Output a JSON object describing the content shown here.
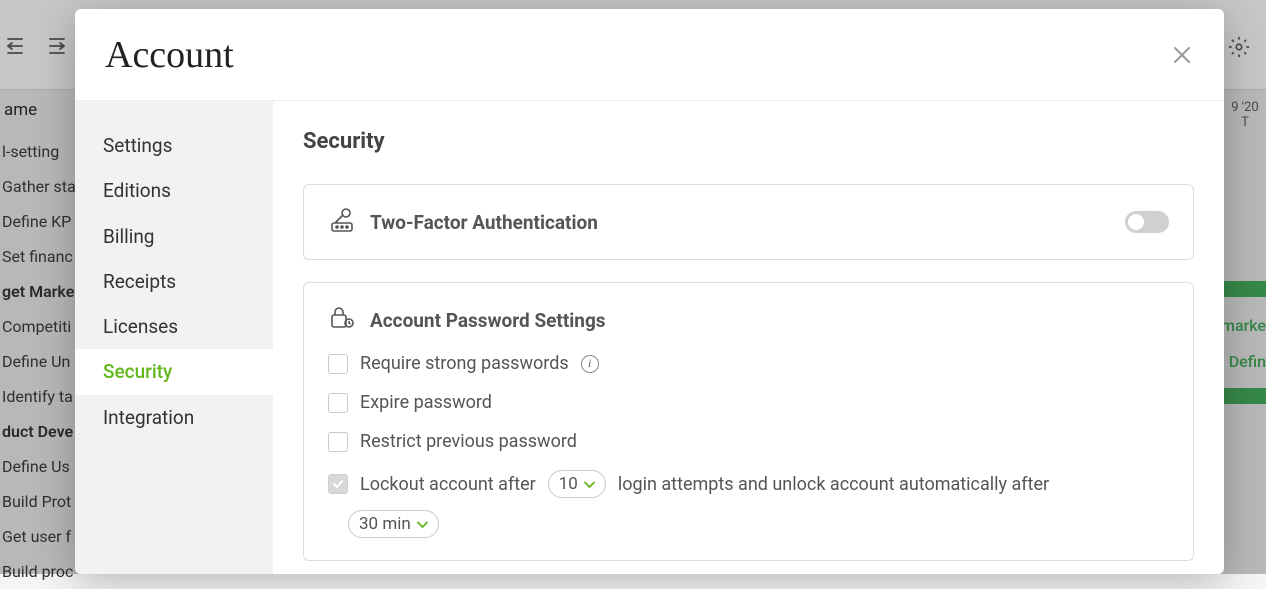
{
  "background": {
    "name_header": "ame",
    "right_date_top": "9 '20",
    "right_date_bottom": "T",
    "right_green_tasks": [
      "marke",
      "Defin"
    ],
    "tasks": [
      {
        "label": "l-setting",
        "bold": false
      },
      {
        "label": "Gather sta",
        "bold": false
      },
      {
        "label": "Define KP",
        "bold": false
      },
      {
        "label": "Set financ",
        "bold": false
      },
      {
        "label": "get Marke",
        "bold": true
      },
      {
        "label": "Competiti",
        "bold": false
      },
      {
        "label": "Define Un",
        "bold": false
      },
      {
        "label": "Identify ta",
        "bold": false
      },
      {
        "label": "duct Deve",
        "bold": true
      },
      {
        "label": "Define Us",
        "bold": false
      },
      {
        "label": "Build Prot",
        "bold": false
      },
      {
        "label": "Get user f",
        "bold": false
      },
      {
        "label": "Build proc",
        "bold": false
      }
    ]
  },
  "modal": {
    "title": "Account",
    "sidebar": {
      "items": [
        {
          "label": "Settings",
          "active": false
        },
        {
          "label": "Editions",
          "active": false
        },
        {
          "label": "Billing",
          "active": false
        },
        {
          "label": "Receipts",
          "active": false
        },
        {
          "label": "Licenses",
          "active": false
        },
        {
          "label": "Security",
          "active": true
        },
        {
          "label": "Integration",
          "active": false
        }
      ]
    },
    "content": {
      "heading": "Security",
      "two_factor": {
        "title": "Two-Factor Authentication",
        "enabled": false
      },
      "password_settings": {
        "title": "Account Password Settings",
        "require_strong_label": "Require strong passwords",
        "expire_label": "Expire password",
        "restrict_previous_label": "Restrict previous password",
        "lockout_prefix": "Lockout account after",
        "lockout_attempts": "10",
        "lockout_middle": "login attempts and unlock account automatically after",
        "lockout_duration": "30 min",
        "require_strong_checked": false,
        "expire_checked": false,
        "restrict_previous_checked": false,
        "lockout_checked": true
      }
    }
  }
}
